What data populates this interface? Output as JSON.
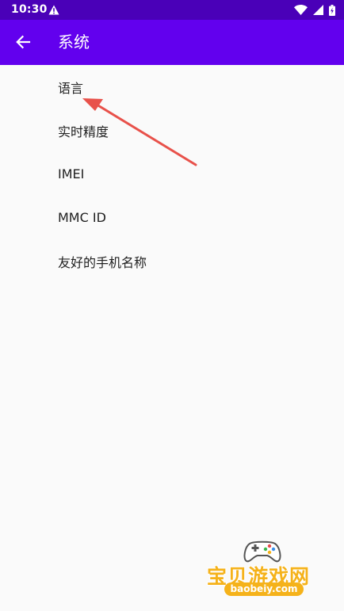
{
  "status_bar": {
    "time": "10:30",
    "icons": [
      "warning-icon",
      "wifi-icon",
      "signal-icon",
      "battery-icon"
    ]
  },
  "app_bar": {
    "title": "系统",
    "back_icon": "arrow-left-icon"
  },
  "settings": {
    "items": [
      {
        "label": "语言"
      },
      {
        "label": "实时精度"
      },
      {
        "label": "IMEI"
      },
      {
        "label": "MMC ID"
      },
      {
        "label": "友好的手机名称"
      }
    ]
  },
  "watermark": {
    "text": "宝贝游戏网",
    "url": "baobeiy.com"
  },
  "colors": {
    "status_bar": "#4a00b8",
    "app_bar": "#6200ee",
    "background": "#fafafa",
    "annotation_arrow": "#e8514a",
    "watermark": "#f5b21a"
  }
}
